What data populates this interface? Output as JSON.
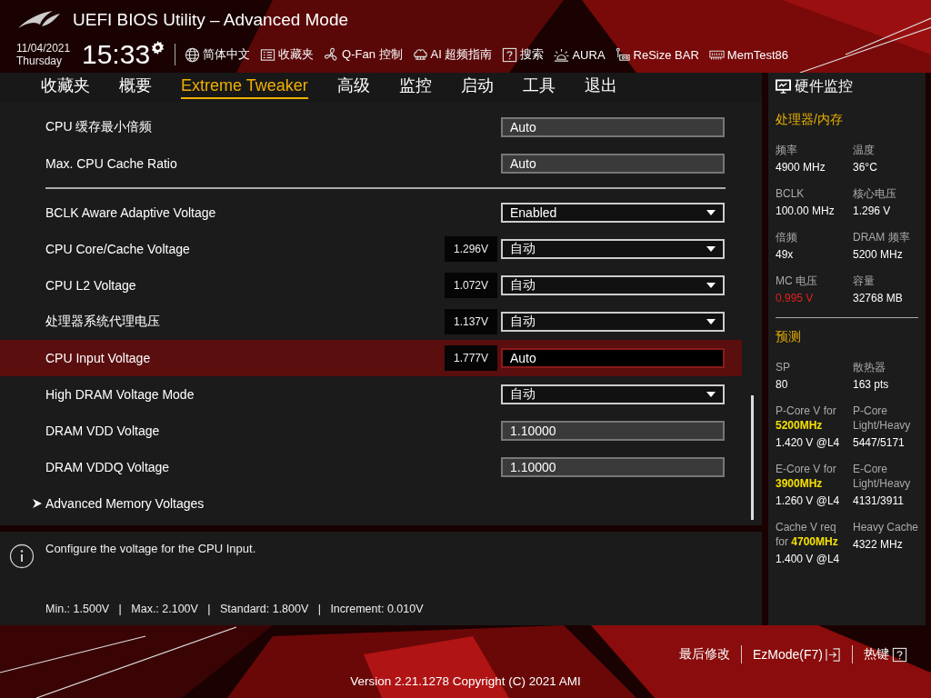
{
  "header": {
    "title": "UEFI BIOS Utility – Advanced Mode",
    "date": "11/04/2021",
    "day": "Thursday",
    "time": "15:33",
    "toolbar": [
      {
        "kind": "globe",
        "label": "简体中文"
      },
      {
        "kind": "list",
        "label": "收藏夹"
      },
      {
        "kind": "fan",
        "label": "Q-Fan 控制"
      },
      {
        "kind": "chip",
        "label": "AI 超频指南"
      },
      {
        "kind": "help",
        "label": "搜索"
      },
      {
        "kind": "lamp",
        "label": "AURA"
      },
      {
        "kind": "resize",
        "label": "ReSize BAR"
      },
      {
        "kind": "memory",
        "label": "MemTest86"
      }
    ]
  },
  "tabs": [
    {
      "label": "收藏夹",
      "selected": false
    },
    {
      "label": "概要",
      "selected": false
    },
    {
      "label": "Extreme Tweaker",
      "selected": true
    },
    {
      "label": "高级",
      "selected": false
    },
    {
      "label": "监控",
      "selected": false
    },
    {
      "label": "启动",
      "selected": false
    },
    {
      "label": "工具",
      "selected": false
    },
    {
      "label": "退出",
      "selected": false
    }
  ],
  "settings": {
    "groups": [
      {
        "rows": [
          {
            "kind": "field",
            "label": "CPU 缓存最小倍频",
            "value": "Auto",
            "selected": false
          },
          {
            "kind": "field",
            "label": "Max. CPU Cache Ratio",
            "value": "Auto",
            "selected": false
          }
        ]
      },
      {
        "rows": [
          {
            "kind": "dropdown",
            "label": "BCLK Aware Adaptive Voltage",
            "value": "Enabled",
            "selected": false
          },
          {
            "kind": "dropdown",
            "label": "CPU Core/Cache Voltage",
            "reading": "1.296V",
            "value": "自动",
            "selected": false
          },
          {
            "kind": "dropdown",
            "label": "CPU L2 Voltage",
            "reading": "1.072V",
            "value": "自动",
            "selected": false
          },
          {
            "kind": "dropdown",
            "label": "处理器系统代理电压",
            "reading": "1.137V",
            "value": "自动",
            "selected": false
          },
          {
            "kind": "field",
            "label": "CPU Input Voltage",
            "reading": "1.777V",
            "value": "Auto",
            "selected": true
          },
          {
            "kind": "dropdown",
            "label": "High DRAM Voltage Mode",
            "value": "自动",
            "selected": false
          },
          {
            "kind": "field",
            "label": "DRAM VDD Voltage",
            "value": "1.10000",
            "selected": false
          },
          {
            "kind": "field",
            "label": "DRAM VDDQ Voltage",
            "value": "1.10000",
            "selected": false
          },
          {
            "kind": "submenu",
            "label": "Advanced Memory Voltages",
            "selected": false
          }
        ]
      }
    ]
  },
  "help": {
    "description": "Configure the voltage for the CPU Input.",
    "range": "Min.: 1.500V   |   Max.: 2.100V   |   Standard: 1.800V   |   Increment: 0.010V"
  },
  "monitor": {
    "title": "硬件监控",
    "sections": [
      {
        "heading": "处理器/内存",
        "items": [
          {
            "label": "频率",
            "value": "4900 MHz",
            "warning": false
          },
          {
            "label": "温度",
            "value": "36°C",
            "warning": false
          },
          {
            "label": "BCLK",
            "value": "100.00 MHz",
            "warning": false
          },
          {
            "label": "核心电压",
            "value": "1.296 V",
            "warning": false
          },
          {
            "label": "倍频",
            "value": "49x",
            "warning": false
          },
          {
            "label": "DRAM 频率",
            "value": "5200 MHz",
            "warning": false
          },
          {
            "label": "MC 电压",
            "value": "0.995 V",
            "warning": true
          },
          {
            "label": "容量",
            "value": "32768 MB",
            "warning": false
          }
        ]
      },
      {
        "heading": "预测",
        "items": [
          {
            "label": "SP",
            "value": "80",
            "warning": false
          },
          {
            "label": "散热器",
            "value": "163 pts",
            "warning": false
          },
          {
            "label": "P-Core V for **5200MHz**",
            "value": "1.420 V @L4",
            "warning": false
          },
          {
            "label": "P-Core Light/Heavy",
            "value": "5447/5171",
            "warning": false
          },
          {
            "label": "E-Core V for **3900MHz**",
            "value": "1.260 V @L4",
            "warning": false
          },
          {
            "label": "E-Core Light/Heavy",
            "value": "4131/3911",
            "warning": false
          },
          {
            "label": "Cache V req for **4700MHz**",
            "value": "1.400 V @L4",
            "warning": false
          },
          {
            "label": "Heavy Cache",
            "value": "4322 MHz",
            "warning": false
          }
        ]
      }
    ]
  },
  "footer": {
    "actions": [
      {
        "kind": "plain",
        "label": "最后修改"
      },
      {
        "kind": "exit",
        "label": "EzMode(F7)"
      },
      {
        "kind": "help",
        "label": "热键"
      }
    ],
    "version": "Version 2.21.1278 Copyright (C) 2021 AMI"
  }
}
